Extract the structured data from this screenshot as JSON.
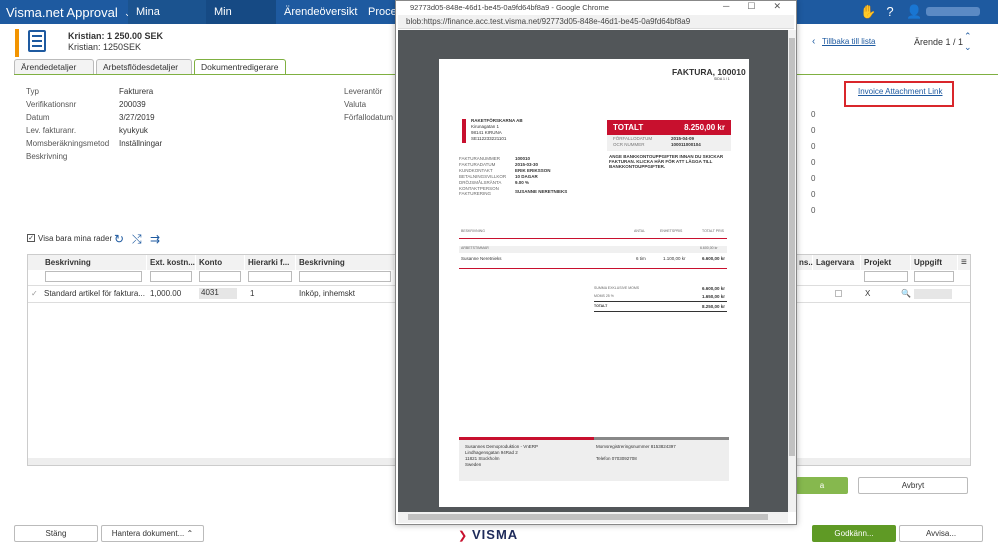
{
  "app": {
    "title": "Visma.net Approval",
    "nav": [
      "Mina ärenden",
      "Min historik",
      "Ärendeöversikt",
      "Proces"
    ]
  },
  "header": {
    "line1": "Kristian: 1 250.00 SEK",
    "line2": "Kristian: 1250SEK",
    "back_link": "Tillbaka till lista",
    "page_indicator": "Ärende 1 / 1"
  },
  "inner_tabs": [
    "Ärendedetaljer",
    "Arbetsflödesdetaljer",
    "Dokumentredigerare"
  ],
  "fields": [
    {
      "label": "Typ",
      "value": "Fakturera"
    },
    {
      "label": "Verifikationsnr",
      "value": "200039"
    },
    {
      "label": "Datum",
      "value": "3/27/2019"
    },
    {
      "label": "Lev. fakturanr.",
      "value": "kyukyuk"
    },
    {
      "label": "Momsberäkningsmetod",
      "value": "Inställningar"
    },
    {
      "label": "Beskrivning",
      "value": ""
    }
  ],
  "fields_right": [
    "Leverantör",
    "Valuta",
    "Förfallodatum"
  ],
  "invoice_link": "Invoice Attachment Link",
  "filter": {
    "checkbox_label": "Visa bara mina rader"
  },
  "grid": {
    "headers": [
      "Beskrivning",
      "Ext. kostn...",
      "Konto",
      "Hierarki f...",
      "Beskrivning"
    ],
    "right_headers": [
      "ns...",
      "Lagervara",
      "Projekt",
      "Uppgift"
    ],
    "row": [
      "Standard artikel för faktura...",
      "1,000.00",
      "4031",
      "1",
      "Inköp, inhemskt"
    ],
    "row_right": {
      "project": "X"
    }
  },
  "buttons": {
    "stang": "Stäng",
    "hantera": "Hantera dokument...",
    "godkann": "Godkänn...",
    "avvisa": "Avvisa...",
    "avbryt": "Avbryt"
  },
  "popup": {
    "title": "92773d05-848e-46d1-be45-0a9fd64bf8a9 - Google Chrome",
    "url": "blob:https://finance.acc.test.visma.net/92773d05-848e-46d1-be45-0a9fd64bf8a9"
  },
  "invoice": {
    "heading": "FAKTURA, 100010",
    "page": "SIDA 1 / 1",
    "sender": [
      "RAKETFÖRSKARNA AB",
      "Kirunagatan 1",
      "98141 KIRUNA",
      "SE112233221101"
    ],
    "total_label": "TOTALT",
    "total_value": "8.250,00 kr",
    "due_label": "FÖRFALLODATUM",
    "due_value": "2015-04-09",
    "ocr_label": "OCR NUMMER",
    "ocr_value": "100011000104",
    "notice": "ANGE BANKKONTOUPPGIFTER INNAN DU SKICKAR FAKTURAN. KLICKA HÄR FÖR ATT LÄGGA TILL BANKKONTOUPPGIFTER.",
    "meta": [
      [
        "FAKTURANUMMER",
        "100010"
      ],
      [
        "FAKTURADATUM",
        "2015-03-30"
      ],
      [
        "KUNDKONTAKT",
        "ERIK ERIKSSON"
      ],
      [
        "BETALNINGSVILLKOR",
        "10 DAGAR"
      ],
      [
        "DRÖJSMÅLSRÄNTA",
        "9.00 %"
      ],
      [
        "KONTAKTPERSON FAKTURERING",
        "SUSANNE NERETNIEKS"
      ]
    ],
    "cols": [
      "BESKRIVNING",
      "ANTAL",
      "ENHETSPRIS",
      "TOTALT PRIS"
    ],
    "group": "ARBETSTIMMAR",
    "group_total": "6.600,00 kr",
    "line": {
      "desc": "Susanne Neretnieks",
      "qty": "6 tim",
      "price": "1.100,00 kr",
      "total": "6.600,00 kr"
    },
    "sums": [
      [
        "SUMMA EXKLUSIVE MOMS",
        "6.600,00 kr"
      ],
      [
        "MOMS 25 %",
        "1.650,00 kr"
      ],
      [
        "TOTALT",
        "8.250,00 kr"
      ]
    ],
    "footer_left": [
      "Susannes Demoproduktion - VnERP",
      "Lindhagensgatan 94Rad 2",
      "11821 Stockholm",
      "Sweden"
    ],
    "footer_right": [
      "Momsregistreringsnummer 8153824397",
      "",
      "Telefon 0703092708"
    ]
  },
  "brand": "VISMA",
  "colors": {
    "primary": "#1e5aa0",
    "accent": "#f29400",
    "approve": "#5f9a25",
    "invoice_red": "#c8102e"
  }
}
